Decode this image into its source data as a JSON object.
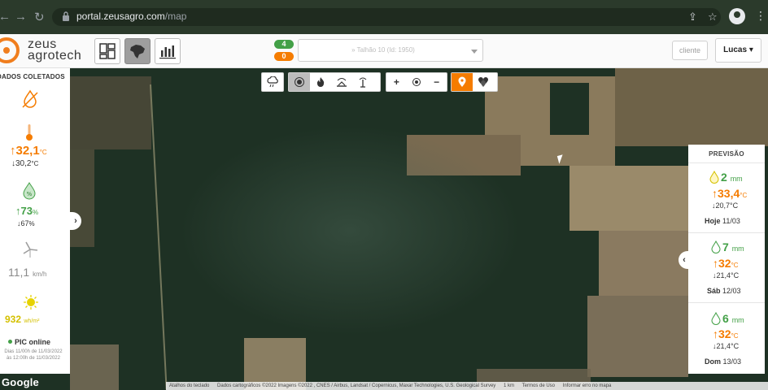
{
  "browser": {
    "url_host": "portal.zeusagro.com",
    "url_path": "/map"
  },
  "header": {
    "brand_line1": "zeus",
    "brand_line2": "agrotech",
    "counter_green": "4",
    "counter_orange": "0",
    "station_select": "» Talhão 10 (Id: 1950)",
    "client_button": "cliente",
    "user_button": "Lucas"
  },
  "map_toolbar": {
    "zoom_in": "+",
    "zoom_out": "−"
  },
  "left_panel": {
    "title": "DADOS COLETADOS",
    "temperature_max": "32,1",
    "temperature_max_unit": "°C",
    "temperature_min": "30,2",
    "temperature_min_unit": "°C",
    "humidity_max": "73",
    "humidity_max_unit": "%",
    "humidity_min": "67",
    "humidity_min_unit": "%",
    "wind_speed": "11,1",
    "wind_unit": "km/h",
    "radiation": "932",
    "radiation_unit": "wh/m²",
    "status": "PIC online",
    "status_note": "Dias 11/00h de 11/03/2022 às 12:00h de 11/03/2022"
  },
  "forecast": {
    "title": "PREVISÃO",
    "days": [
      {
        "rain": "2",
        "rain_unit": "mm",
        "t_max": "33,4",
        "t_min": "20,7",
        "t_unit": "°C",
        "day": "Hoje",
        "date": "11/03"
      },
      {
        "rain": "7",
        "rain_unit": "mm",
        "t_max": "32",
        "t_min": "21,4",
        "t_unit": "°C",
        "day": "Sáb",
        "date": "12/03"
      },
      {
        "rain": "6",
        "rain_unit": "mm",
        "t_max": "32",
        "t_min": "21,4",
        "t_unit": "°C",
        "day": "Dom",
        "date": "13/03"
      }
    ]
  },
  "footer": {
    "google": "Google",
    "shortcuts": "Atalhos do teclado",
    "map_data": "Dados cartográficos ©2022 Imagens ©2022 , CNES / Airbus, Landsat / Copernicus, Maxar Technologies, U.S. Geological Survey",
    "scale": "1 km",
    "terms": "Termos de Uso",
    "report": "Informar erro no mapa"
  },
  "colors": {
    "brand_orange": "#f07e1e",
    "temp_orange": "#f57c00",
    "humidity_green": "#43a047",
    "radiation_yellow": "#d4c000",
    "wind_gray": "#8a8a8a"
  }
}
